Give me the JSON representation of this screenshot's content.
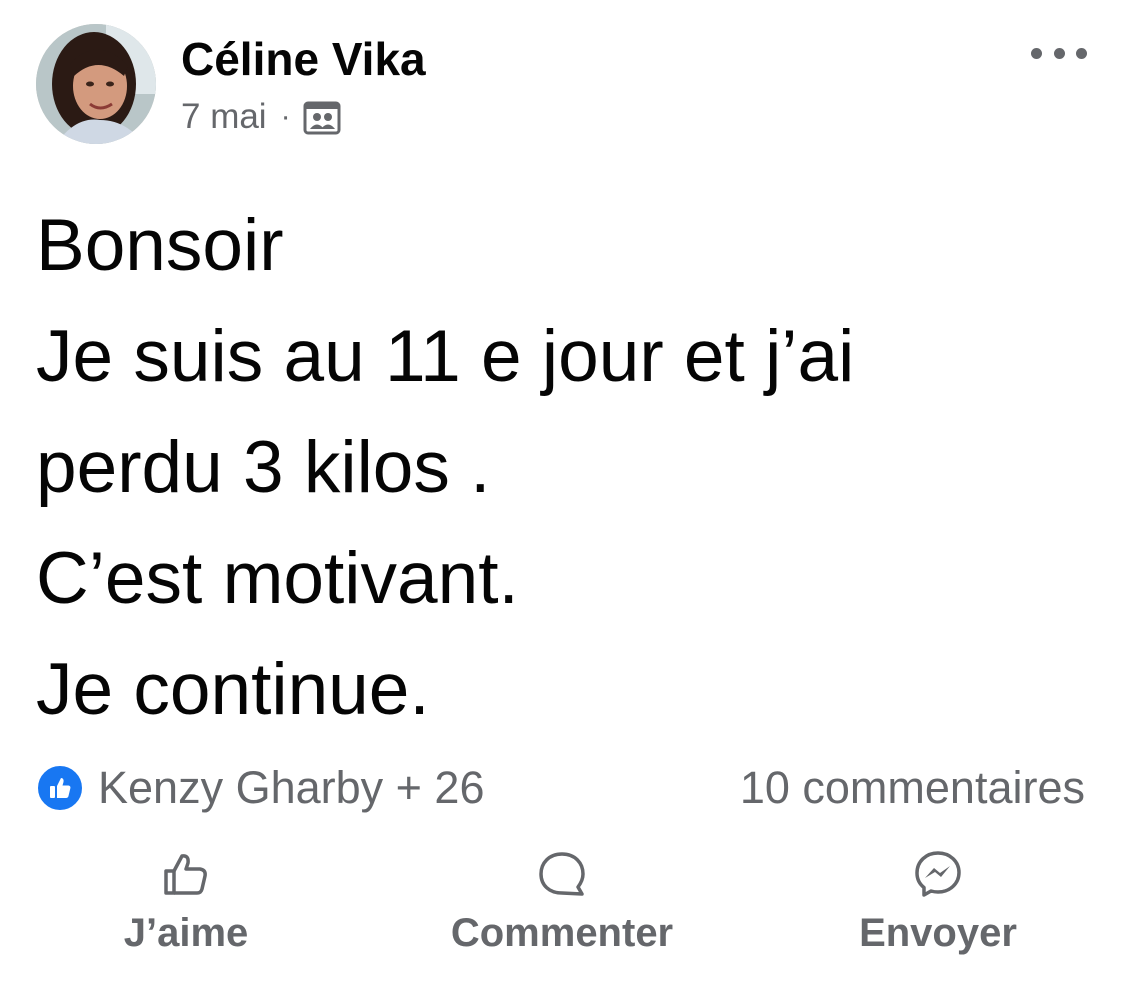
{
  "post": {
    "author": "Céline Vika",
    "date": "7 mai",
    "separator": "·",
    "audience_icon": "friends-icon",
    "text_lines": [
      "Bonsoir",
      "Je suis au 11 e jour et j’ai",
      "perdu 3 kilos .",
      "C’est motivant.",
      "Je continue."
    ]
  },
  "reactions": {
    "icon": "like-icon",
    "label": "Kenzy Gharby + 26",
    "comments": "10 commentaires"
  },
  "actions": {
    "like": "J’aime",
    "comment": "Commenter",
    "send": "Envoyer"
  },
  "colors": {
    "accent": "#1877f2",
    "secondary_text": "#65676b",
    "primary_text": "#050505",
    "background": "#ffffff"
  }
}
